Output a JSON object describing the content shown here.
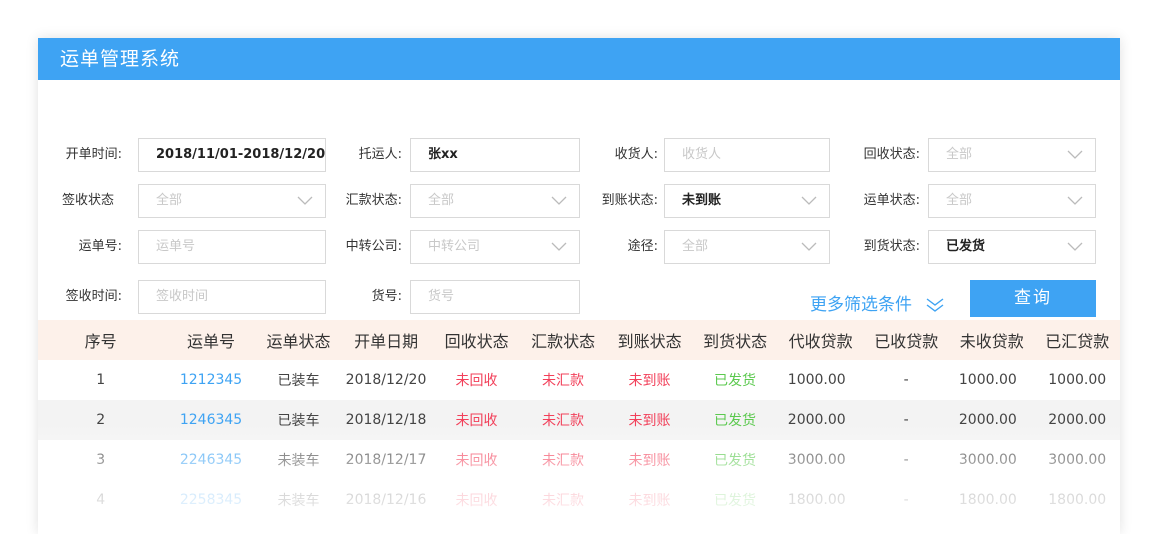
{
  "app": {
    "title": "运单管理系统"
  },
  "filters": {
    "open_time": {
      "label": "开单时间:",
      "value": "2018/11/01-2018/12/20"
    },
    "shipper": {
      "label": "托运人:",
      "value": "张xx"
    },
    "receiver": {
      "label": "收货人:",
      "placeholder": "收货人"
    },
    "recycle_status": {
      "label": "回收状态:",
      "placeholder": "全部"
    },
    "sign_status": {
      "label": "签收状态",
      "placeholder": "全部"
    },
    "remit_status": {
      "label": "汇款状态:",
      "placeholder": "全部"
    },
    "arrival_account_status": {
      "label": "到账状态:",
      "value": "未到账"
    },
    "waybill_status": {
      "label": "运单状态:",
      "placeholder": "全部"
    },
    "waybill_no": {
      "label": "运单号:",
      "placeholder": "运单号"
    },
    "transfer_company": {
      "label": "中转公司:",
      "placeholder": "中转公司"
    },
    "route": {
      "label": "途径:",
      "placeholder": "全部"
    },
    "arrival_status": {
      "label": "到货状态:",
      "value": "已发货"
    },
    "sign_time": {
      "label": "签收时间:",
      "placeholder": "签收时间"
    },
    "goods_no": {
      "label": "货号:",
      "placeholder": "货号"
    }
  },
  "actions": {
    "more_filters": "更多筛选条件",
    "query": "查询"
  },
  "table": {
    "headers": [
      "序号",
      "运单号",
      "运单状态",
      "开单日期",
      "回收状态",
      "汇款状态",
      "到账状态",
      "到货状态",
      "代收贷款",
      "已收贷款",
      "未收贷款",
      "已汇贷款"
    ],
    "rows": [
      [
        "1",
        "1212345",
        "已装车",
        "2018/12/20",
        "未回收",
        "未汇款",
        "未到账",
        "已发货",
        "1000.00",
        "-",
        "1000.00",
        "1000.00"
      ],
      [
        "2",
        "1246345",
        "已装车",
        "2018/12/18",
        "未回收",
        "未汇款",
        "未到账",
        "已发货",
        "2000.00",
        "-",
        "2000.00",
        "2000.00"
      ],
      [
        "3",
        "2246345",
        "未装车",
        "2018/12/17",
        "未回收",
        "未汇款",
        "未到账",
        "已发货",
        "3000.00",
        "-",
        "3000.00",
        "3000.00"
      ],
      [
        "4",
        "2258345",
        "未装车",
        "2018/12/16",
        "未回收",
        "未汇款",
        "未到账",
        "已发货",
        "1800.00",
        "-",
        "1800.00",
        "1800.00"
      ]
    ]
  },
  "colors": {
    "accent": "#3ea3f3",
    "red": "#f2405a",
    "green": "#5bc94e",
    "header_bg": "#fdf1ea"
  }
}
